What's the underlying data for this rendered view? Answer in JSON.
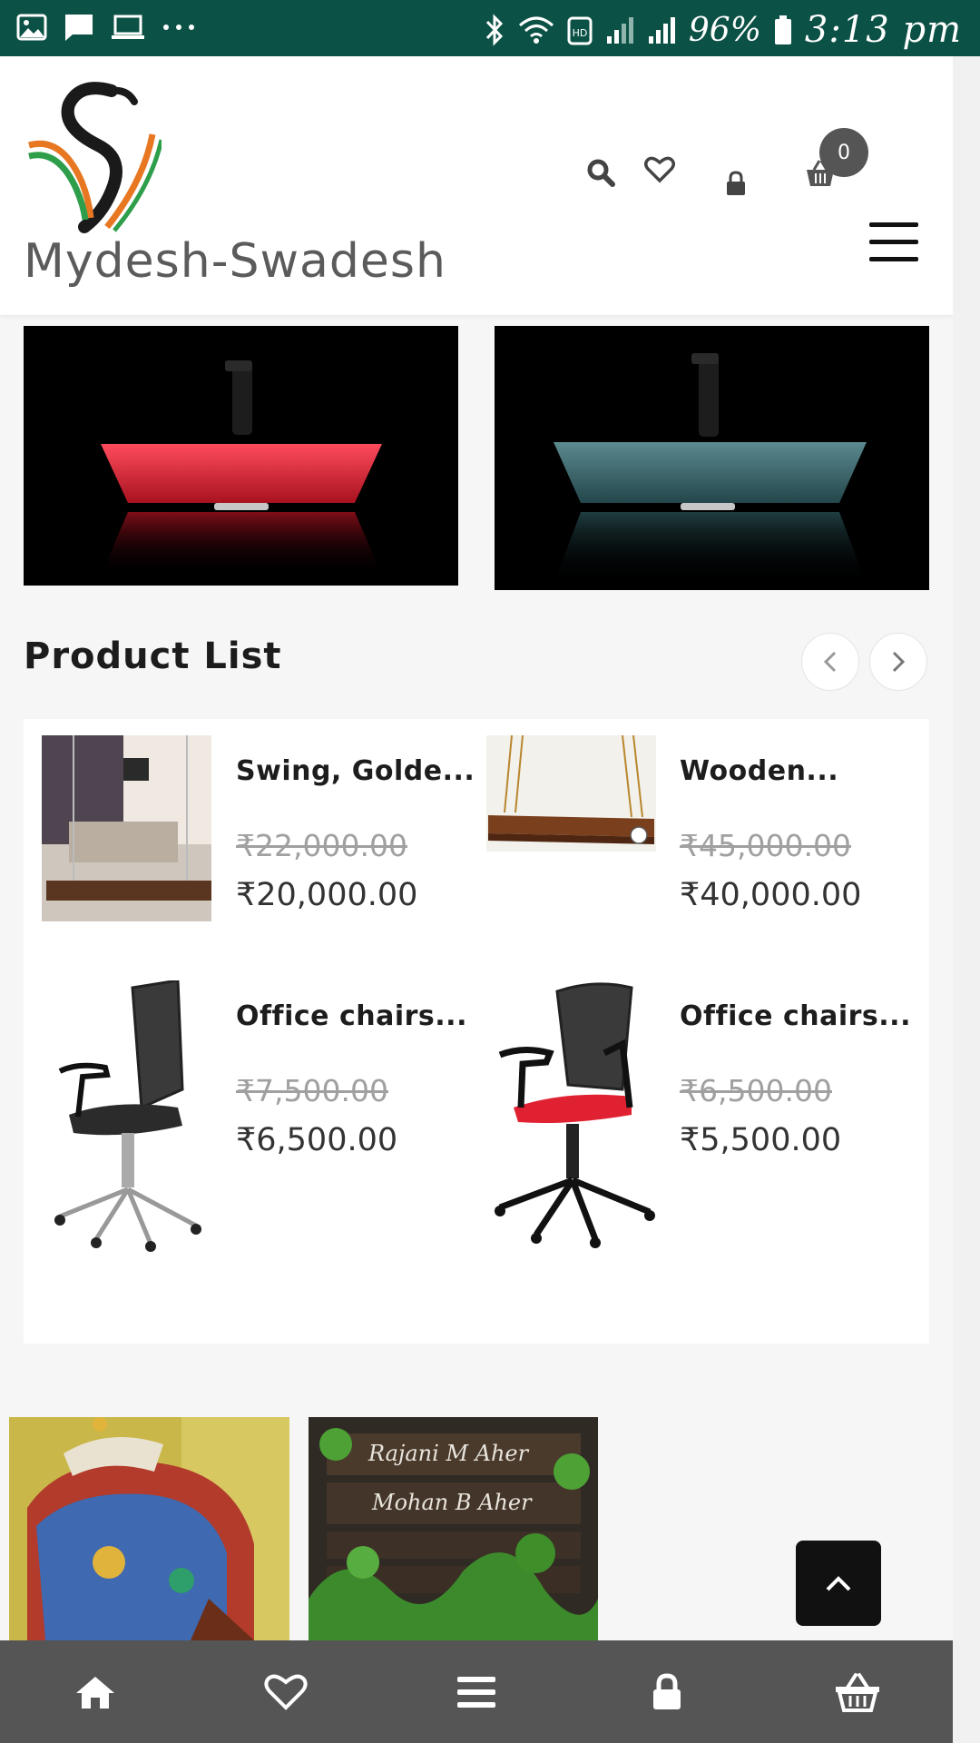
{
  "status_bar": {
    "battery_percent": "96%",
    "time": "3:13 pm",
    "left_icons": [
      "gallery-icon",
      "message-icon",
      "laptop-icon",
      "more-icon"
    ],
    "right_icons": [
      "bluetooth-icon",
      "wifi-icon",
      "hd-icon",
      "signal-icon",
      "signal-icon",
      "battery-icon"
    ]
  },
  "header": {
    "brand_name": "Mydesh-Swadesh",
    "cart_count": "0",
    "icons": [
      "search-icon",
      "heart-icon",
      "lock-icon",
      "basket-icon",
      "menu-icon"
    ]
  },
  "banners": [
    {
      "subject": "red glass vessel sink with black faucet",
      "accent": "#d8283a"
    },
    {
      "subject": "teal glass vessel sink with black faucet",
      "accent": "#3f6f73"
    }
  ],
  "product_list": {
    "title": "Product List",
    "prev_icon": "chevron-left-icon",
    "next_icon": "chevron-right-icon",
    "items": [
      {
        "name": "Swing, Golde...",
        "old_price": "₹22,000.00",
        "price": "₹20,000.00"
      },
      {
        "name": "Wooden...",
        "old_price": "₹45,000.00",
        "price": "₹40,000.00"
      },
      {
        "name": "Office chairs...",
        "old_price": "₹7,500.00",
        "price": "₹6,500.00"
      },
      {
        "name": "Office chairs...",
        "old_price": "₹6,500.00",
        "price": "₹5,500.00"
      }
    ]
  },
  "name_plate": {
    "line1": "Rajani M Aher",
    "line2": "Mohan B Aher"
  },
  "bottom_nav": {
    "items": [
      "home-icon",
      "heart-icon",
      "menu-icon",
      "lock-icon",
      "basket-icon"
    ]
  },
  "colors": {
    "status_bar": "#0b5145",
    "bottom_nav": "#555555",
    "back_to_top": "#111111"
  }
}
